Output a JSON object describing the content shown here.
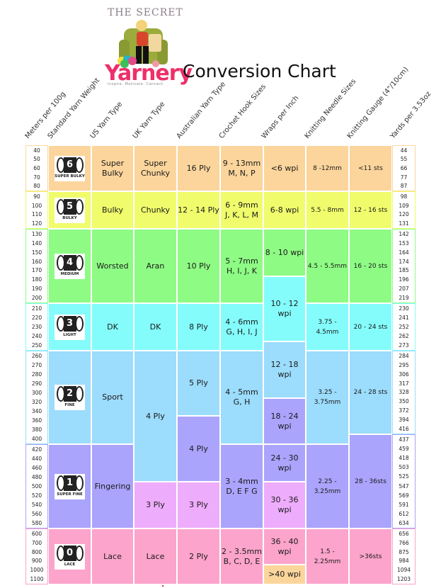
{
  "header": {
    "logo_top_text": "THE SECRET",
    "brand": "Yarnery",
    "tagline": "Inspire. Motivate. Connect.",
    "title": "Conversion Chart"
  },
  "columns": [
    "Meters per 100g",
    "Standard Yarn Weight",
    "US Yarn Type",
    "UK Yarn Type",
    "Australian Yarn Type",
    "Crochet Hook Sizes",
    "Wraps per Inch",
    "Knitting Needle Sizes",
    "Knitting Gauge (4\"/10cm)",
    "Yards per 3.53oz"
  ],
  "colors": {
    "super_bulky": "#fcd59c",
    "bulky": "#f0fc6c",
    "medium": "#8efc84",
    "light": "#84fcfc",
    "fine": "#9cdcfc",
    "super_fine": "#aaa4fc",
    "lace": "#fca4cc",
    "pink_light": "#eeacfc",
    "brand_pink": "#ee2f6a"
  },
  "weights": [
    {
      "number": "6",
      "label": "SUPER BULKY",
      "meters": [
        "40",
        "50",
        "60",
        "70",
        "80"
      ],
      "yards": [
        "44",
        "55",
        "66",
        "77",
        "87"
      ],
      "us": "Super\nBulky",
      "uk": "Super\nChunky",
      "au": "16 Ply",
      "hook": "9 - 13mm",
      "hook_letters": "M, N, P",
      "wpi": "<6 wpi",
      "needle": "8 -12mm",
      "gauge": "<11 sts"
    },
    {
      "number": "5",
      "label": "BULKY",
      "meters": [
        "90",
        "100",
        "110",
        "120"
      ],
      "yards": [
        "98",
        "109",
        "120",
        "131"
      ],
      "us": "Bulky",
      "uk": "Chunky",
      "au": "12 - 14 Ply",
      "hook": "6 - 9mm",
      "hook_letters": "J, K, L, M",
      "wpi": "6-8 wpi",
      "needle": "5.5 - 8mm",
      "gauge": "12 - 16 sts"
    },
    {
      "number": "4",
      "label": "MEDIUM",
      "meters": [
        "130",
        "140",
        "150",
        "160",
        "170",
        "180",
        "190",
        "200"
      ],
      "yards": [
        "142",
        "153",
        "164",
        "174",
        "185",
        "196",
        "207",
        "219"
      ],
      "us": "Worsted",
      "uk": "Aran",
      "au": "10 Ply",
      "hook": "5 - 7mm",
      "hook_letters": "H, I, J, K",
      "wpi": "8 - 10 wpi",
      "needle": "4.5 - 5.5mm",
      "gauge": "16 - 20 sts"
    },
    {
      "number": "3",
      "label": "LIGHT",
      "meters": [
        "210",
        "220",
        "230",
        "240",
        "250"
      ],
      "yards": [
        "230",
        "241",
        "252",
        "262",
        "273"
      ],
      "us": "DK",
      "uk": "DK",
      "au": "8 Ply",
      "hook": "4 - 6mm",
      "hook_letters": "G, H, I, J",
      "wpi": "10 - 12 wpi",
      "needle": "3.75 - 4.5mm",
      "gauge": "20 - 24 sts"
    },
    {
      "number": "2",
      "label": "FINE",
      "meters": [
        "260",
        "270",
        "280",
        "290",
        "300",
        "320",
        "340",
        "360",
        "380",
        "400"
      ],
      "yards": [
        "284",
        "295",
        "306",
        "317",
        "328",
        "350",
        "372",
        "394",
        "416"
      ],
      "us": "Sport",
      "uk": "4 Ply",
      "au": "5 Ply",
      "au_b": "4 Ply",
      "hook": "4 - 5mm",
      "hook_letters": "G, H",
      "wpi": "12 - 18 wpi",
      "wpi_b": "18 - 24 wpi",
      "needle": "3.25 - 3.75mm",
      "gauge": "24 - 28 sts"
    },
    {
      "number": "1",
      "label": "SUPER FINE",
      "meters": [
        "420",
        "440",
        "460",
        "480",
        "500",
        "520",
        "540",
        "560",
        "580"
      ],
      "yards": [
        "437",
        "459",
        "418",
        "503",
        "525",
        "547",
        "569",
        "591",
        "612",
        "634"
      ],
      "us": "Fingering",
      "uk": "3 Ply",
      "au": "3 Ply",
      "hook": "3 - 4mm",
      "hook_letters": "D, E F G",
      "wpi": "24 - 30 wpi",
      "wpi_b": "30 - 36 wpi",
      "needle": "2.25 - 3.25mm",
      "gauge": "28 - 36sts"
    },
    {
      "number": "0",
      "label": "LACE",
      "meters": [
        "600",
        "700",
        "800",
        "900",
        "1000",
        "1100"
      ],
      "yards": [
        "656",
        "766",
        "875",
        "984",
        "1094",
        "1203"
      ],
      "us": "Lace",
      "uk": "Lace",
      "au": "2 Ply",
      "hook": "2 - 3.5mm",
      "hook_letters": "B, C, D, E",
      "wpi": "36 - 40 wpi",
      "wpi_b": ">40 wpi",
      "needle": "1.5 - 2.25mm",
      "gauge": ">36sts"
    }
  ]
}
